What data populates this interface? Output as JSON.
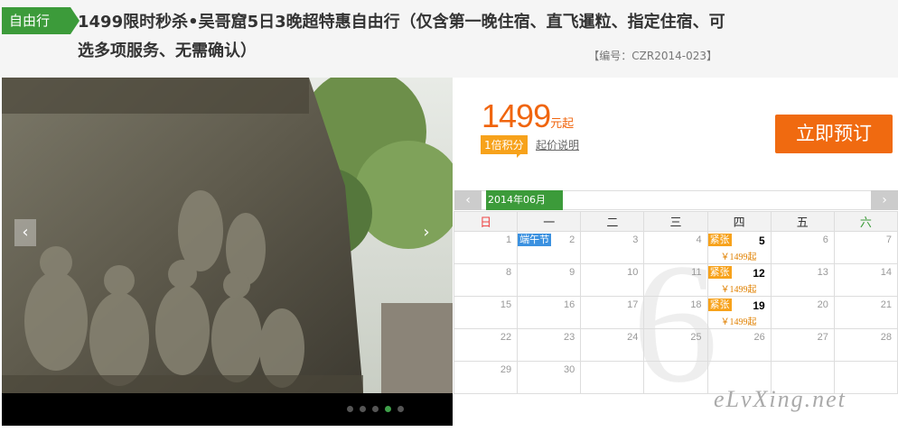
{
  "header": {
    "tag": "自由行",
    "title": "1499限时秒杀•吴哥窟5日3晚超特惠自由行（仅含第一晚住宿、直飞暹粒、指定住宿、可选多项服务、无需确认）",
    "code": "【编号：CZR2014-023】"
  },
  "slideshow": {
    "prev": "‹",
    "next": "›",
    "dots": 5,
    "active_dot": 4
  },
  "price": {
    "value": "1499",
    "unit": "元起",
    "points": "1倍积分",
    "explain": "起价说明",
    "book": "立即预订"
  },
  "calendar": {
    "month": "2014年06月",
    "prev": "‹",
    "next": "›",
    "weekdays": [
      "日",
      "一",
      "二",
      "三",
      "四",
      "五",
      "六"
    ],
    "big_month": "6",
    "rows": [
      [
        {
          "d": "1"
        },
        {
          "d": "2",
          "badge": "端午节"
        },
        {
          "d": "3"
        },
        {
          "d": "4"
        },
        {
          "d": "5",
          "badge": "紧张",
          "price": "￥1499起"
        },
        {
          "d": "6"
        },
        {
          "d": "7"
        }
      ],
      [
        {
          "d": "8"
        },
        {
          "d": "9"
        },
        {
          "d": "10"
        },
        {
          "d": "11"
        },
        {
          "d": "12",
          "badge": "紧张",
          "price": "￥1499起"
        },
        {
          "d": "13"
        },
        {
          "d": "14"
        }
      ],
      [
        {
          "d": "15"
        },
        {
          "d": "16"
        },
        {
          "d": "17"
        },
        {
          "d": "18"
        },
        {
          "d": "19",
          "badge": "紧张",
          "price": "￥1499起"
        },
        {
          "d": "20"
        },
        {
          "d": "21"
        }
      ],
      [
        {
          "d": "22"
        },
        {
          "d": "23"
        },
        {
          "d": "24"
        },
        {
          "d": "25"
        },
        {
          "d": "26"
        },
        {
          "d": "27"
        },
        {
          "d": "28"
        }
      ],
      [
        {
          "d": "29"
        },
        {
          "d": "30"
        },
        {
          "d": ""
        },
        {
          "d": ""
        },
        {
          "d": ""
        },
        {
          "d": ""
        },
        {
          "d": ""
        }
      ]
    ]
  },
  "watermark": "eLvXing.net",
  "colors": {
    "green": "#3c9b3a",
    "orange": "#f06a10",
    "badge": "#f7a21b"
  }
}
